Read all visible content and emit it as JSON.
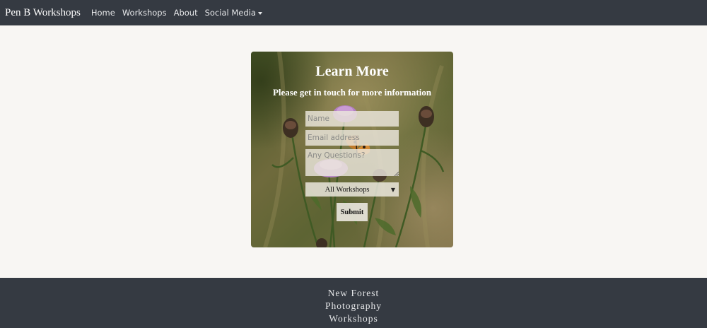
{
  "navbar": {
    "brand": "Pen B Workshops",
    "links": [
      "Home",
      "Workshops",
      "About",
      "Social Media"
    ]
  },
  "card": {
    "title": "Learn More",
    "subtitle": "Please get in touch for more information",
    "form": {
      "name_placeholder": "Name",
      "email_placeholder": "Email address",
      "questions_placeholder": "Any Questions?",
      "workshop_select_value": "All Workshops",
      "submit_label": "Submit"
    },
    "background_image": "purple-thistle-flowers-with-butterfly"
  },
  "footer": {
    "lines": [
      "New Forest",
      "Photography",
      "Workshops"
    ]
  },
  "colors": {
    "navbar_bg": "#353a42",
    "page_bg": "#f8f6f3",
    "footer_bg": "#353a42"
  }
}
